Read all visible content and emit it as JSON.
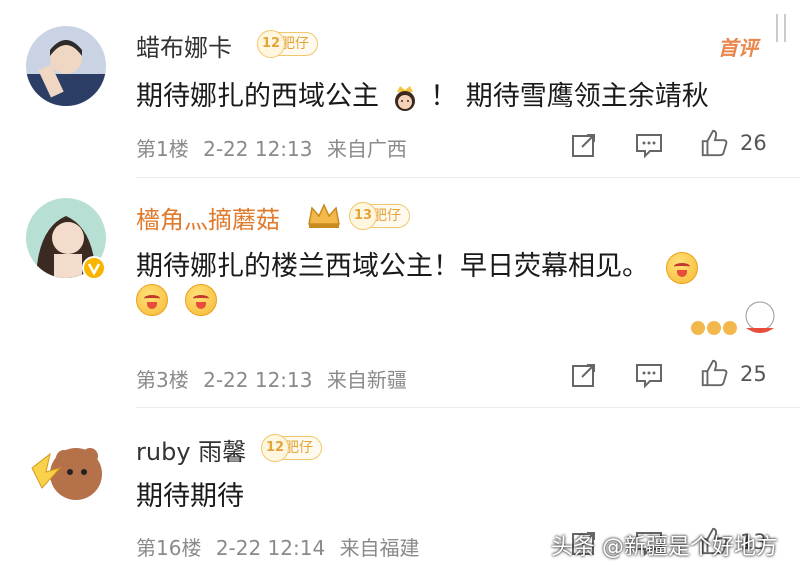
{
  "comments": [
    {
      "username": "蜡布娜卡",
      "level": "12",
      "badge_label": "肥仔",
      "pinned_label": "首评",
      "text": "期待娜扎的西域公主",
      "text_after_emoji": "！ 期待雪鹰领主余靖秋",
      "floor": "第1楼",
      "time": "2-22 12:13",
      "location": "来自广西",
      "likes": "26"
    },
    {
      "username": "檣角灬摘蘑菇",
      "level": "13",
      "badge_label": "肥仔",
      "text": "期待娜扎的楼兰西域公主！早日荧幕相见。",
      "floor": "第3楼",
      "time": "2-22 12:13",
      "location": "来自新疆",
      "likes": "25"
    },
    {
      "username": "ruby 雨馨",
      "level": "12",
      "badge_label": "肥仔",
      "text": "期待期待",
      "floor": "第16楼",
      "time": "2-22 12:14",
      "location": "来自福建",
      "likes": "13"
    }
  ],
  "watermark": "头条 @新疆是个好地方",
  "colors": {
    "accent": "#e9874c",
    "badge": "#f2c76a",
    "meta": "#8a8a8a"
  },
  "icons": [
    "share-icon",
    "comment-icon",
    "like-icon",
    "crown-icon",
    "princess-emoji-icon",
    "laughing-emoji-icon",
    "verified-icon"
  ]
}
